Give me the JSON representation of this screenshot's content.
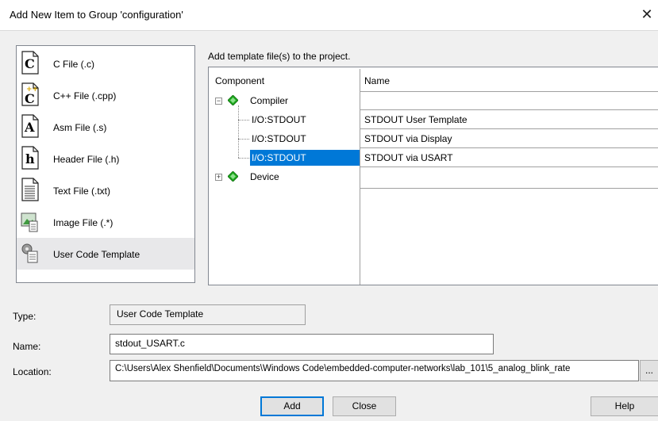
{
  "window": {
    "title": "Add New Item to Group 'configuration'"
  },
  "file_types": [
    {
      "label": "C File (.c)",
      "icon": "c-file-icon"
    },
    {
      "label": "C++ File (.cpp)",
      "icon": "cpp-file-icon"
    },
    {
      "label": "Asm File (.s)",
      "icon": "asm-file-icon"
    },
    {
      "label": "Header File (.h)",
      "icon": "header-file-icon"
    },
    {
      "label": "Text File (.txt)",
      "icon": "text-file-icon"
    },
    {
      "label": "Image File (.*)",
      "icon": "image-file-icon"
    },
    {
      "label": "User Code Template",
      "icon": "user-code-template-icon",
      "selected": true
    }
  ],
  "template_panel": {
    "heading": "Add template file(s) to the project.",
    "col_component": "Component",
    "col_name": "Name",
    "groups": [
      {
        "label": "Compiler",
        "expanded": true,
        "icon": "component-gem-icon",
        "children": [
          {
            "component": "I/O:STDOUT",
            "name": "STDOUT User Template"
          },
          {
            "component": "I/O:STDOUT",
            "name": "STDOUT via Display"
          },
          {
            "component": "I/O:STDOUT",
            "name": "STDOUT via USART",
            "selected": true
          }
        ]
      },
      {
        "label": "Device",
        "expanded": false,
        "icon": "component-gem-icon",
        "children": []
      }
    ],
    "accent_color": "#0078d7",
    "gem_color": "#1faa1f"
  },
  "form": {
    "type_label": "Type:",
    "type_value": "User Code Template",
    "name_label": "Name:",
    "name_value": "stdout_USART.c",
    "location_label": "Location:",
    "location_value": "C:\\Users\\Alex Shenfield\\Documents\\Windows Code\\embedded-computer-networks\\lab_101\\5_analog_blink_rate",
    "browse_label": "..."
  },
  "buttons": {
    "add": "Add",
    "close": "Close",
    "help": "Help"
  }
}
